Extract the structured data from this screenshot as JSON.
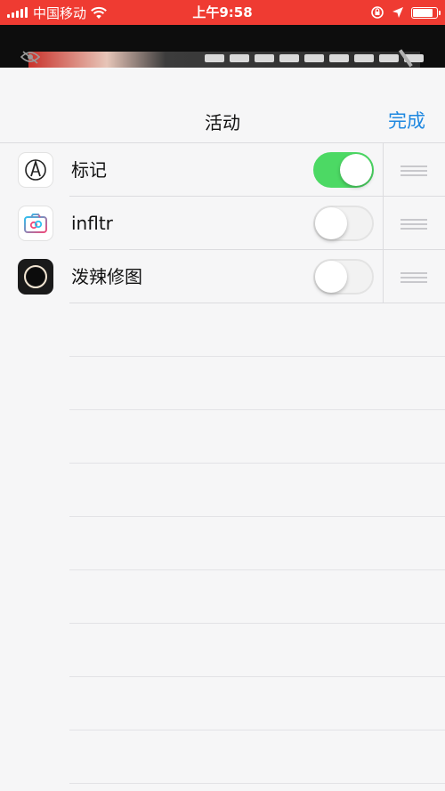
{
  "status_bar": {
    "carrier": "中国移动",
    "time": "上午9:58"
  },
  "nav": {
    "title": "活动",
    "done_label": "完成"
  },
  "activities": [
    {
      "name": "标记",
      "icon": "markup-pen-icon",
      "enabled": true
    },
    {
      "name": "infltr",
      "icon": "infltr-camera-icon",
      "enabled": false
    },
    {
      "name": "泼辣修图",
      "icon": "polarr-ring-icon",
      "enabled": false
    }
  ],
  "colors": {
    "status_bar": "#ef3b32",
    "accent": "#1f88e0",
    "toggle_on": "#4cd964"
  }
}
